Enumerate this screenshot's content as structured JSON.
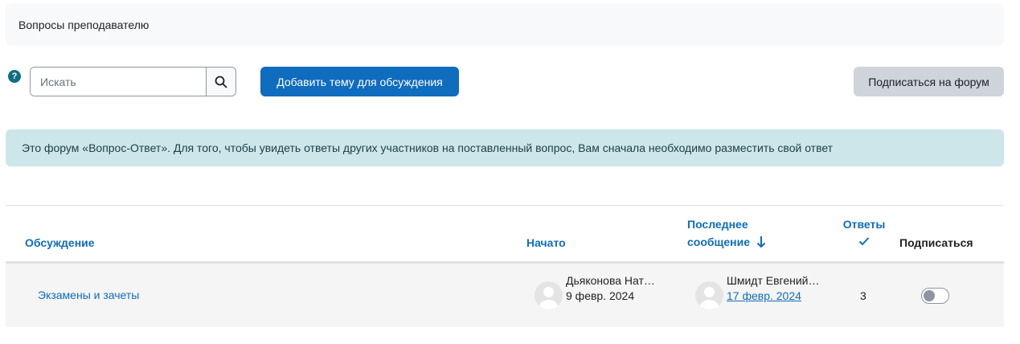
{
  "forum": {
    "intro": "Вопросы преподавателю",
    "search_placeholder": "Искать",
    "add_topic_label": "Добавить тему для обсуждения",
    "subscribe_forum_label": "Подписаться на форум",
    "alert": "Это форум «Вопрос-Ответ». Для того, чтобы увидеть ответы других участников на поставленный вопрос, Вам сначала необходимо разместить свой ответ"
  },
  "table": {
    "headers": {
      "discussion": "Обсуждение",
      "started": "Начато",
      "last_post_line1": "Последнее",
      "last_post_line2": "сообщение",
      "replies": "Ответы",
      "subscribe": "Подписаться"
    },
    "rows": [
      {
        "topic": "Экзамены и зачеты",
        "started_by": "Дьяконова Нат…",
        "started_date": "9 февр. 2024",
        "last_by": "Шмидт Евгений…",
        "last_date": "17 февр. 2024",
        "replies": "3",
        "subscribed": false
      }
    ]
  },
  "colors": {
    "primary": "#0f6cbf",
    "alert_bg": "#cce6ea",
    "secondary_btn": "#ced4da"
  },
  "icons": {
    "help": "question-circle-icon",
    "search": "search-icon",
    "sort": "arrow-down-icon",
    "replies": "check-icon",
    "avatar": "user-avatar-icon"
  }
}
